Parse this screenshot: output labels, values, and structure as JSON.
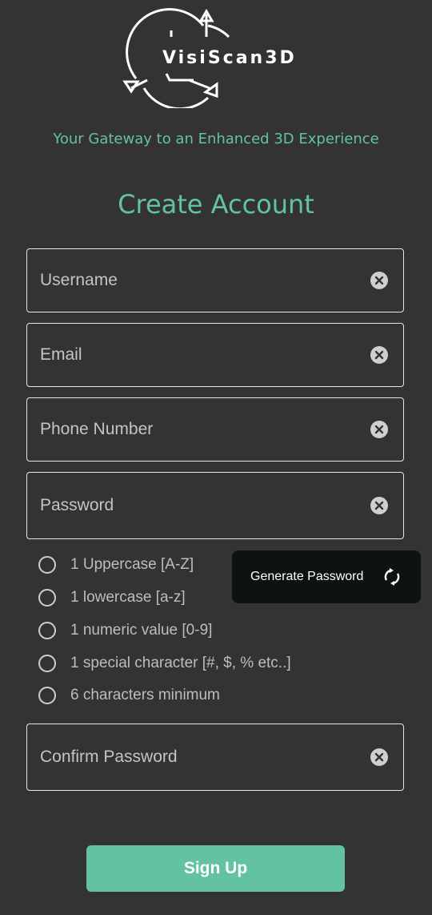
{
  "brand": {
    "name": "VisiScan3D",
    "logo_icon": "triangle-arrows-logo"
  },
  "tagline": "Your Gateway to an Enhanced 3D Experience",
  "title": "Create Account",
  "form": {
    "username": {
      "placeholder": "Username",
      "value": ""
    },
    "email": {
      "placeholder": "Email",
      "value": ""
    },
    "phone": {
      "placeholder": "Phone Number",
      "value": ""
    },
    "password": {
      "placeholder": "Password",
      "value": ""
    },
    "confirm_password": {
      "placeholder": "Confirm Password",
      "value": ""
    },
    "clear_icon": "clear-circle-icon"
  },
  "password_rules": [
    {
      "label": "1 Uppercase [A-Z]",
      "checked": false
    },
    {
      "label": "1 lowercase [a-z]",
      "checked": false
    },
    {
      "label": "1 numeric value [0-9]",
      "checked": false
    },
    {
      "label": "1 special character [#, $, % etc..]",
      "checked": false
    },
    {
      "label": "6 characters minimum",
      "checked": false
    }
  ],
  "generate_button": {
    "label": "Generate Password",
    "icon": "refresh-icon"
  },
  "signup_button": {
    "label": "Sign Up"
  },
  "colors": {
    "background": "#333333",
    "accent": "#63c2a0",
    "dark_button": "#0d1312"
  }
}
